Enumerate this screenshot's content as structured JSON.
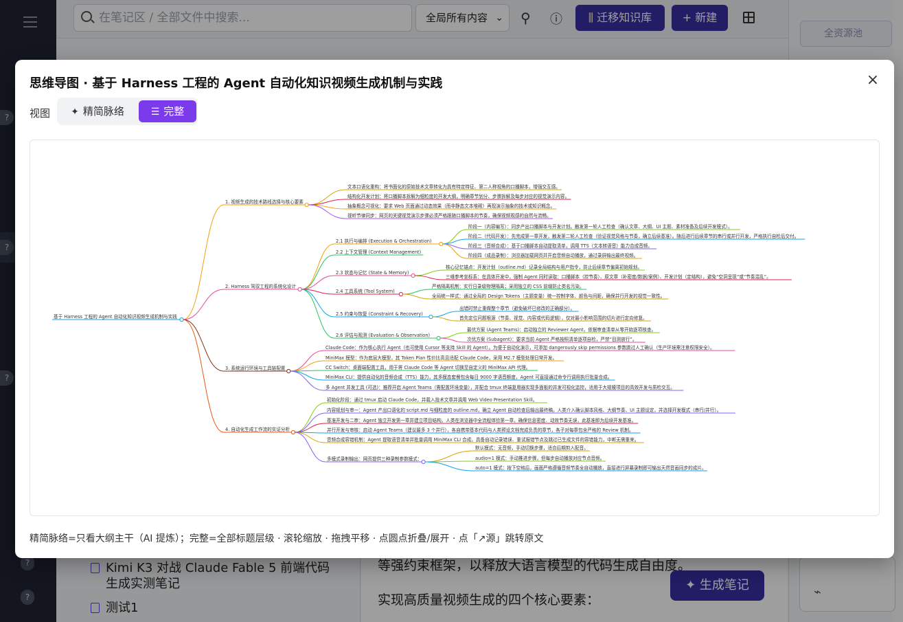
{
  "app": {
    "search_placeholder": "在笔记区 / 全部文件中搜索...",
    "scope_label": "全局所有内容",
    "migrate_button": "迁移知识库",
    "new_button": "新建",
    "source_pool": "全资源池",
    "notes": [
      "Kimi K3 对战 Claude Fable 5 前端代码",
      "生成实测笔记",
      "测试1"
    ],
    "content_lines": [
      "等强约束框架，以释放大语言模型的代码生成自由度。",
      "实现高质量视频生成的四个核心要素："
    ],
    "generate_note_button": "生成笔记",
    "help_glyph": "?",
    "accent_color": "#3730a3"
  },
  "modal": {
    "title": "思维导图 · 基于 Harness 工程的 Agent 自动化知识视频生成机制与实践",
    "close_glyph": "×",
    "view_label": "视图",
    "view_options": [
      {
        "label": "精简脉络",
        "glyph": "✦",
        "selected": false
      },
      {
        "label": "完整",
        "glyph": "☰",
        "selected": true
      }
    ],
    "footer": "精简脉络=只看大纲主干（AI 提炼）；完整=全部标题层级 · 滚轮缩放 · 拖拽平移 · 点圆点折叠/展开 · 点「↗源」跳转原文",
    "selected_color": "#7c3aed"
  },
  "mindmap": {
    "root": "基于 Harness 工程的 Agent 自动化知识视频生成机制与实践",
    "branches": [
      {
        "label": "1. 视频生成的技术路线选择与核心要素",
        "color": "#f59e0b",
        "children": [
          {
            "label": "文本口语化重构：将书面化的原始技术文章转化为具有特定特征、第二人称视角的口播脚本，增强交互感。",
            "color": "#d9a400"
          },
          {
            "label": "结构化开发计划：将口播脚本拆解为细粒度的开发大纲，明确章节划分、步骤拆解及每步对应的视觉演示内容。",
            "color": "#e11d48"
          },
          {
            "label": "抽象概念可视化：要求 Web 页面通过动态效果（而非静态文本堆砌）再现演示抽象的技术或知识概念。",
            "color": "#f59e0b"
          },
          {
            "label": "视听节律同步：网页的关键视觉演示步骤必须严格跟随口播脚本的节奏，确保视频观感的自然与流畅。",
            "color": "#a855f7"
          }
        ]
      },
      {
        "label": "2. Harness 驾驭工程的系统化设计",
        "color": "#ec4899",
        "children": [
          {
            "label": "2.1 执行与编排 (Execution & Orchestration)",
            "color": "#f59e0b",
            "children": [
              {
                "label": "阶段一（内容编写）：同步产出口播脚本与开发计划。触发第一轮人工检查（确认文章、大纲、UI 主题、素材准备及后续开发模式）。",
                "color": "#84cc16"
              },
              {
                "label": "阶段二（代码开发）：先完成第一章开发，触发第二轮人工检查（验证视觉风格与节奏，确立后续基准）。随后进行后续章节的串行或并行开发，严格执行自检后交付。",
                "color": "#0ea5e9"
              },
              {
                "label": "阶段三（音频合成）：基于口播脚本自动提取清单，调用 TTS（文本转语音）能力合成音频。",
                "color": "#8b5cf6"
              },
              {
                "label": "阶段四（成品录制）：浏览器加载网页并开启音频自动播放，通过录屏输出最终视频。",
                "color": "#f59e0b"
              }
            ]
          },
          {
            "label": "2.2 上下文管理 (Context Management)",
            "color": "#22c55e"
          },
          {
            "label": "2.3 状态与记忆 (State & Memory)",
            "color": "#ec4899",
            "children": [
              {
                "label": "核心记忆锚点：开发计划（outline.md）记录全局结构与用户指令，防止后续章节偏离初始规划。",
                "color": "#84cc16"
              },
              {
                "label": "三维参考坐标系：在具体开发中，强制 Agent 同时读取：口播脚本（控节奏）、原文章（补密度/数据/案例）、开发计划（定结构），避免“空洞呈现”或“节奏混乱”。",
                "color": "#e11d48"
              }
            ]
          },
          {
            "label": "2.4 工具系统 (Tool System)",
            "color": "#e11d48",
            "children": [
              {
                "label": "严格隔离机制：实行日录级物理隔离；采用独立的 CSS 前缀防止类名污染。",
                "color": "#22c55e"
              },
              {
                "label": "全局统一样式：通过全局的 Design Tokens（主题变量）统一控制字体、颜色与间距，确保并行开发的视觉一致性。",
                "color": "#d9a400"
              }
            ]
          },
          {
            "label": "2.5 约束与恢复 (Constraint & Recovery)",
            "color": "#0ea5e9",
            "children": [
              {
                "label": "出错时禁止重做整个章节（避免破坏已修改的正确部分）。",
                "color": "#0ea5e9"
              },
              {
                "label": "首先定位问题根源（节奏、视觉、内容或代码逻辑），仅对最小影响范围的切片进行定向修复。",
                "color": "#d9a400"
              }
            ]
          },
          {
            "label": "2.6 评估与观测 (Evaluation & Observation)",
            "color": "#22c55e",
            "children": [
              {
                "label": "最优方案 (Agent Teams)：启动独立的 Reviewer Agent，依据审查清单从零开始逐项核查。",
                "color": "#84cc16"
              },
              {
                "label": "次优方案 (Subagent)：要求当前 Agent 严格按照清单逐项自检，严禁“目测放行”。",
                "color": "#ec4899"
              }
            ]
          }
        ]
      },
      {
        "label": "3. 系统运行环境与工具链配置",
        "color": "#7c2d12",
        "children": [
          {
            "label": "Claude Code：作为核心执行 Agent（也可使用 Cursor 等支持 Skill 的 Agent）。为便于自动化演示，可添加 dangerously skip permissions 参数跳过人工确认（生产环境需注意权限安全）。",
            "color": "#ec4899"
          },
          {
            "label": "MiniMax 模型：作为底层大模型，其 Token Plan 性价比高且适配 Claude Code，采用 M2.7 模型处理日常开发。",
            "color": "#f59e0b"
          },
          {
            "label": "CC Switch：桌面端配置工具，用于将 Claude Code 等 Agent 切换至自定义的 MiniMax API 代理。",
            "color": "#22c55e"
          },
          {
            "label": "MiniMax CLI：提供自动化的音频合成（TTS）能力，其多模态套餐包含每日 9000 字语音额度，Agent 可直接通过命令行调用执行批量合成。",
            "color": "#0ea5e9"
          },
          {
            "label": "多 Agent 并发工具 (可选)：推荐开启 Agent Teams（需配置环境变量），并配合 tmux 终端复用器实现多面板的并发可视化监控，适用于大规模项目的高效开发与质检交互。",
            "color": "#8b5cf6"
          }
        ]
      },
      {
        "label": "4. 自动化生成工作流的实证分析",
        "color": "#ea580c",
        "children": [
          {
            "label": "初始化阶段：通过 tmux 启动 Claude Code，并载入技术文章并调用 Web Video Presentation Skill。",
            "color": "#84cc16"
          },
          {
            "label": "内容规划与审一：Agent 产出口语化的 script.md 与细粒度的 outline.md，确立 Agent 自动检查后输出最终稿。人类介入确认脚本风格、大纲节奏、UI 主题设定，并选择开发模式（串行/并行）。",
            "color": "#8b5cf6"
          },
          {
            "label": "基准开发与二审：Agent 独立开发第一章并建立项目结构。人类在浏览器中全流程体验第一章，确保信息密度、动效节奏无误，此基准即为后续开发基准。",
            "color": "#e11d48"
          },
          {
            "label": "并行开发与审核：启动 Agent Teams（建议最多 3 个并行），各自携带基本代码与人类预设文档完成负责的章节，各子对每章包含严格的 Review 机制。",
            "color": "#0ea5e9"
          },
          {
            "label": "音频合成容错机制：Agent 提取语音清单并批量调用 MiniMax CLI 合成。具备自动记录错误、重试报错节点及跳过已生成文件的容错能力，中断无需重来。",
            "color": "#d9a400"
          },
          {
            "label": "多模式录制输出：网页提供三种录制参数模式：",
            "color": "#8b5cf6",
            "children": [
              {
                "label": "默认模式：无音频，手动切换步骤，适合后期剪入配音。",
                "color": "#d9a400"
              },
              {
                "label": "audio=1 模式：手动推进步骤，但每步自动播放对应节点音频。",
                "color": "#84cc16"
              },
              {
                "label": "auto=1 模式：按下空格后，画面严格遵循音频节奏全自动播放，直接进行屏幕录制即可输出天然音画同步的成片。",
                "color": "#0ea5e9"
              }
            ]
          }
        ]
      }
    ]
  }
}
